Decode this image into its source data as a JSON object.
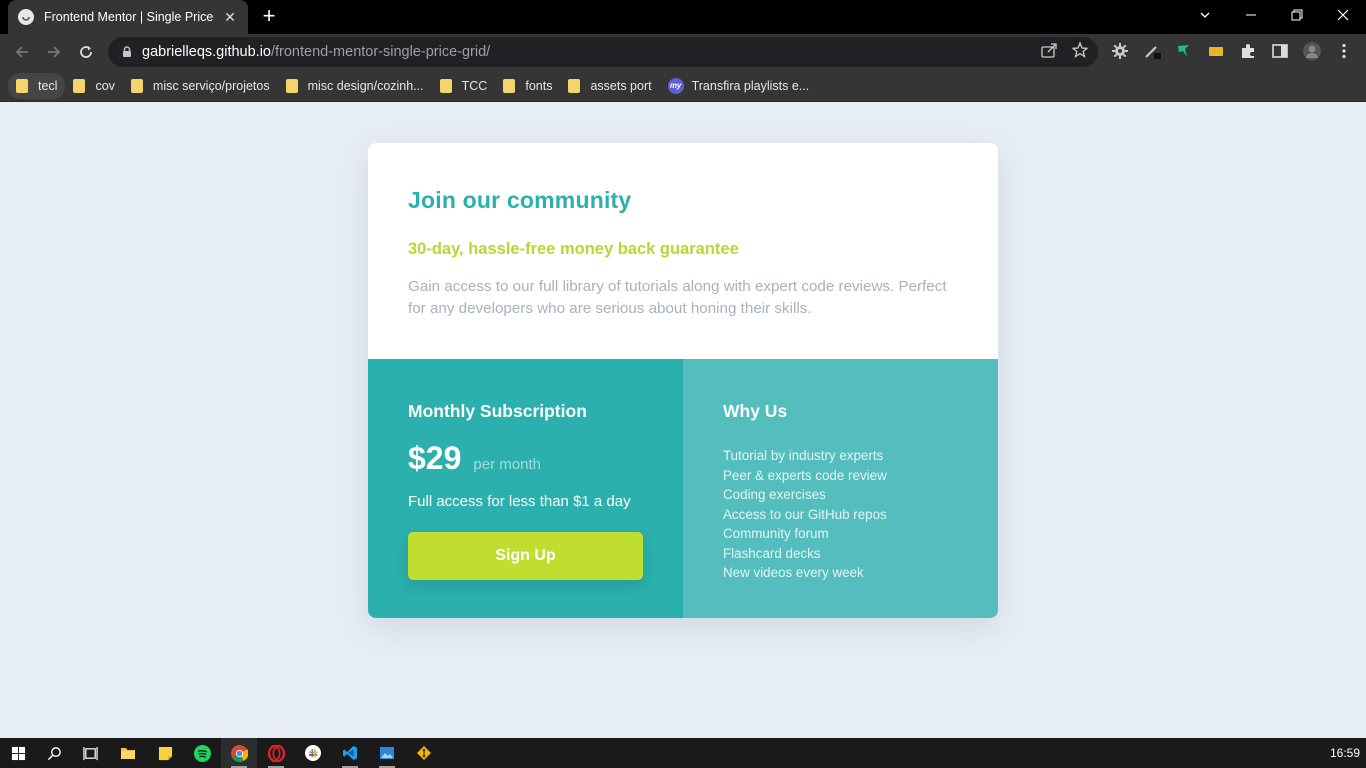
{
  "browser": {
    "tab_title": "Frontend Mentor | Single Price G",
    "url_host": "gabrielleqs.github.io",
    "url_path": "/frontend-mentor-single-price-grid/",
    "bookmarks": [
      {
        "label": "tecl",
        "icon": "folder-icon"
      },
      {
        "label": "cov",
        "icon": "folder-icon"
      },
      {
        "label": "misc serviço/projetos",
        "icon": "folder-icon"
      },
      {
        "label": "misc design/cozinh...",
        "icon": "folder-icon"
      },
      {
        "label": "TCC",
        "icon": "folder-icon"
      },
      {
        "label": "fonts",
        "icon": "folder-icon"
      },
      {
        "label": "assets port",
        "icon": "folder-icon"
      },
      {
        "label": "Transfira playlists e...",
        "icon": "my-icon"
      }
    ],
    "my_badge": "my"
  },
  "page": {
    "title": "Join our community",
    "subtitle": "30-day, hassle-free money back guarantee",
    "description": "Gain access to our full library of tutorials along with expert code reviews. Perfect for any developers who are serious about honing their skills.",
    "subscription": {
      "heading": "Monthly Subscription",
      "price": "$29",
      "period": "per month",
      "access": "Full access for less than $1 a day",
      "button": "Sign Up"
    },
    "why_us": {
      "heading": "Why Us",
      "items": [
        "Tutorial by industry experts",
        "Peer & experts code review",
        "Coding exercises",
        "Access to our GitHub repos",
        "Community forum",
        "Flashcard decks",
        "New videos every week"
      ]
    }
  },
  "taskbar": {
    "clock": "16:59"
  },
  "colors": {
    "primary": "#2bb0ad",
    "accent": "#bfde30",
    "secondary": "#54bdbd",
    "background": "#e6edf5"
  }
}
